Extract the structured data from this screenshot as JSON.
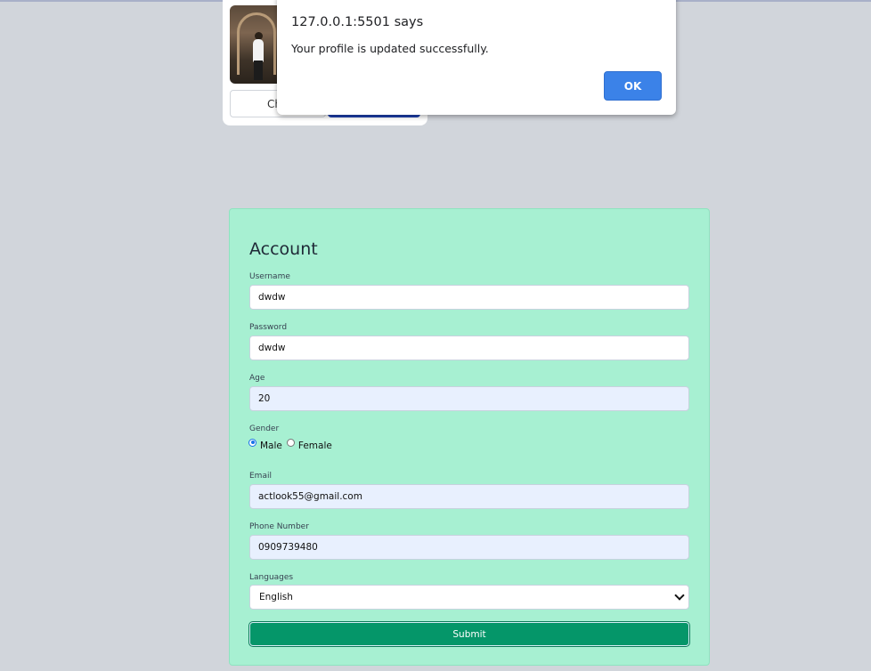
{
  "alert": {
    "title": "127.0.0.1:5501 says",
    "message": "Your profile is updated successfully.",
    "ok_label": "OK"
  },
  "avatar_card": {
    "choose_label": "Ch"
  },
  "account": {
    "title": "Account",
    "username": {
      "label": "Username",
      "value": "dwdw"
    },
    "password": {
      "label": "Password",
      "value": "dwdw"
    },
    "age": {
      "label": "Age",
      "value": "20"
    },
    "gender": {
      "label": "Gender",
      "options": [
        "Male",
        "Female"
      ],
      "selected": "Male"
    },
    "email": {
      "label": "Email",
      "value": "actlook55@gmail.com"
    },
    "phone": {
      "label": "Phone Number",
      "value": "0909739480"
    },
    "languages": {
      "label": "Languages",
      "selected": "English"
    },
    "submit_label": "Submit"
  },
  "colors": {
    "page_background": "#d1d5db",
    "card_background": "#a7f0d2",
    "submit_button": "#059669",
    "ok_button": "#3b82e8",
    "upload_button": "#1e40af"
  }
}
